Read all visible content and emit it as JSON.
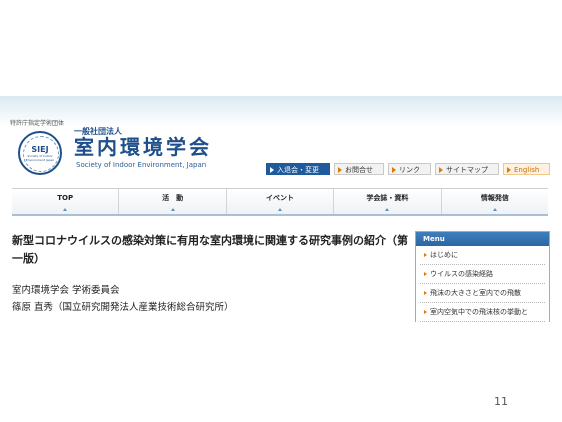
{
  "header": {
    "certification": "特許庁指定学術団体",
    "logo_text": "SIEJ",
    "logo_subtext": "Society of Indoor Environment Japan",
    "org_sub": "一般社団法人",
    "org_title": "室内環境学会",
    "org_en": "Society of Indoor Environment, Japan"
  },
  "top_buttons": [
    {
      "label": "入退会・変更"
    },
    {
      "label": "お問合せ"
    },
    {
      "label": "リンク"
    },
    {
      "label": "サイトマップ"
    },
    {
      "label": "English"
    }
  ],
  "nav": [
    {
      "label": "TOP"
    },
    {
      "label": "活　動"
    },
    {
      "label": "イベント"
    },
    {
      "label": "学会誌・資料"
    },
    {
      "label": "情報発信"
    }
  ],
  "article": {
    "title": "新型コロナウイルスの感染対策に有用な室内環境に関連する研究事例の紹介（第一版）",
    "affiliation_1": "室内環境学会 学術委員会",
    "affiliation_2": "篠原 直秀（国立研究開発法人産業技術総合研究所）"
  },
  "menu": {
    "title": "Menu",
    "items": [
      {
        "label": "はじめに"
      },
      {
        "label": "ウイルスの感染経路"
      },
      {
        "label": "飛沫の大きさと室内での飛散"
      },
      {
        "label": "室内空気中での飛沫核の挙動と"
      }
    ]
  },
  "page_number": "11",
  "colors": {
    "brand_blue": "#1e4f8a",
    "accent_orange": "#e07b00",
    "menu_header_blue": "#2a66a3"
  }
}
